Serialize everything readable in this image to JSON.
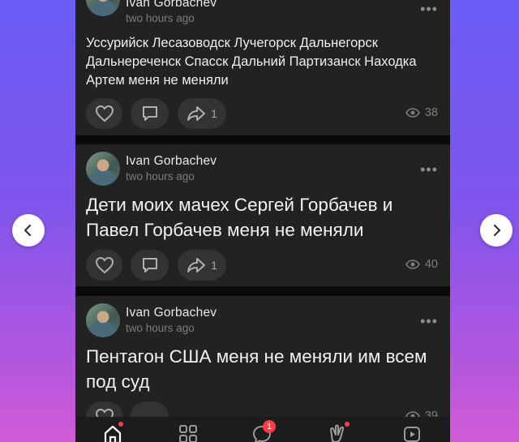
{
  "colors": {
    "background_top": "#6a5cf5",
    "background_bottom": "#d15cd6",
    "card": "#222222",
    "accent_badge": "#ff3b47"
  },
  "posts": [
    {
      "author": "Ivan Gorbachev",
      "time": "two hours ago",
      "text": "Уссурийск Лесазоводск Лучегорск Дальнегорск Дальнереченск Спасск Дальний Партизанск Находка Артем меня не меняли",
      "shares": "1",
      "views": "38"
    },
    {
      "author": "Ivan Gorbachev",
      "time": "two hours ago",
      "text": "Дети моих мачех Сергей Горбачев и Павел Горбачев меня не меняли",
      "shares": "1",
      "views": "40"
    },
    {
      "author": "Ivan Gorbachev",
      "time": "two hours ago",
      "text": "Пентагон США меня не меняли им всем под суд",
      "views": "39"
    }
  ],
  "tabbar": {
    "messages_badge": "1"
  },
  "icons": [
    "heart-icon",
    "comment-icon",
    "share-icon",
    "eye-icon",
    "more-icon",
    "chevron-left-icon",
    "chevron-right-icon",
    "home-icon",
    "services-icon",
    "messages-icon",
    "clips-icon",
    "video-icon"
  ]
}
